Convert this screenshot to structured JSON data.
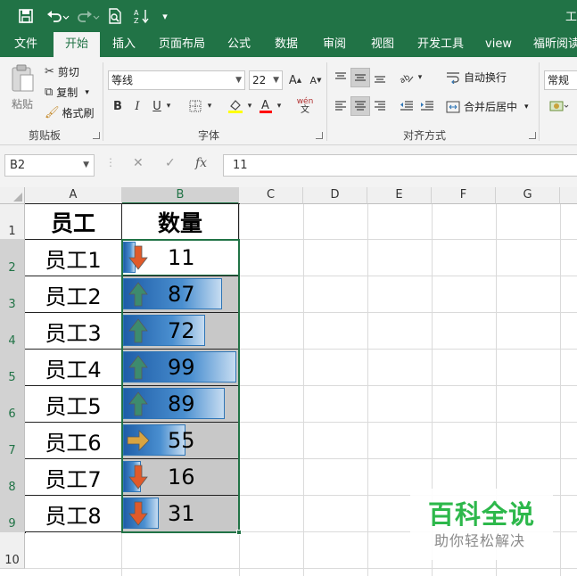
{
  "title_fragment": "工",
  "quick_access": {
    "save_icon": "save-icon",
    "undo_icon": "undo-icon",
    "redo_icon": "redo-icon",
    "print_preview_icon": "print-preview-icon",
    "sort_icon": "sort-ascending-icon",
    "customize_icon": "customize-toolbar-icon"
  },
  "tabs": [
    "文件",
    "开始",
    "插入",
    "页面布局",
    "公式",
    "数据",
    "审阅",
    "视图",
    "开发工具",
    "view",
    "福昕阅读"
  ],
  "active_tab": "开始",
  "ribbon": {
    "clipboard": {
      "paste": "粘贴",
      "cut": "剪切",
      "copy": "复制",
      "format_painter": "格式刷",
      "group": "剪贴板"
    },
    "font": {
      "font_name": "等线",
      "font_size": "22",
      "bold": "B",
      "italic": "I",
      "underline": "U",
      "phonetic": "wén",
      "group": "字体"
    },
    "alignment": {
      "wrap_text": "自动换行",
      "merge_center": "合并后居中",
      "group": "对齐方式"
    },
    "number": {
      "format": "常规"
    }
  },
  "formula_bar": {
    "name_box": "B2",
    "cancel_icon": "✕",
    "enter_icon": "✓",
    "fx_label": "fx",
    "value": "11"
  },
  "columns": [
    "A",
    "B",
    "C",
    "D",
    "E",
    "F",
    "G"
  ],
  "rows": [
    "1",
    "2",
    "3",
    "4",
    "5",
    "6",
    "7",
    "8",
    "9",
    "10"
  ],
  "table": {
    "header_employee": "员工",
    "header_quantity": "数量",
    "rows": [
      {
        "name": "员工1",
        "value": "11",
        "bar_fraction": 0.11,
        "icon": "arrow-down",
        "icon_color": "#e05a2a"
      },
      {
        "name": "员工2",
        "value": "87",
        "bar_fraction": 0.87,
        "icon": "arrow-up",
        "icon_color": "#3d8b6e"
      },
      {
        "name": "员工3",
        "value": "72",
        "bar_fraction": 0.72,
        "icon": "arrow-up",
        "icon_color": "#3d8b6e"
      },
      {
        "name": "员工4",
        "value": "99",
        "bar_fraction": 0.99,
        "icon": "arrow-up",
        "icon_color": "#3d8b6e"
      },
      {
        "name": "员工5",
        "value": "89",
        "bar_fraction": 0.89,
        "icon": "arrow-up",
        "icon_color": "#3d8b6e"
      },
      {
        "name": "员工6",
        "value": "55",
        "bar_fraction": 0.55,
        "icon": "arrow-right",
        "icon_color": "#d9a441"
      },
      {
        "name": "员工7",
        "value": "16",
        "bar_fraction": 0.16,
        "icon": "arrow-down",
        "icon_color": "#e05a2a"
      },
      {
        "name": "员工8",
        "value": "31",
        "bar_fraction": 0.31,
        "icon": "arrow-down",
        "icon_color": "#e05a2a"
      }
    ]
  },
  "watermark": {
    "title": "百科全说",
    "subtitle": "助你轻松解决"
  },
  "colors": {
    "excel_green": "#217346",
    "bar_blue": "#2e75b6"
  }
}
